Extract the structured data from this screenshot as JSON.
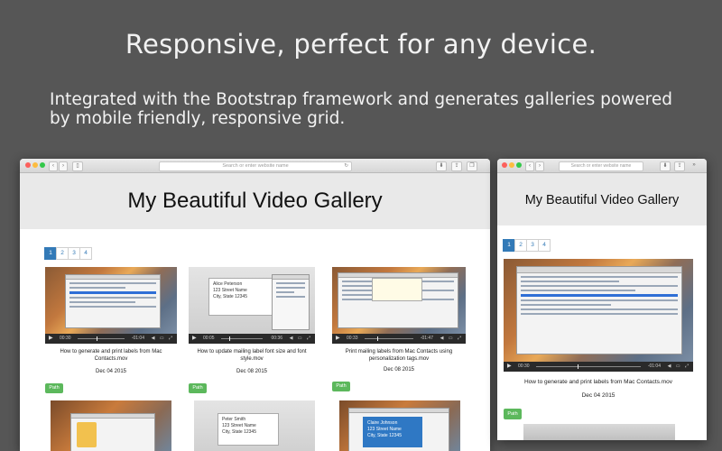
{
  "hero": {
    "title": "Responsive, perfect for any device.",
    "subtitle": "Integrated with the Bootstrap framework and generates galleries powered by mobile friendly, responsive grid."
  },
  "browser": {
    "address_placeholder": "Search or enter website name"
  },
  "gallery": {
    "title": "My Beautiful Video Gallery",
    "pages": [
      "1",
      "2",
      "3",
      "4"
    ],
    "active_page": "1",
    "path_label": "Path",
    "videos": [
      {
        "caption": "How to generate and print labels from Mac Contacts.mov",
        "date": "Dec 04 2015",
        "time_elapsed": "00:30",
        "time_remaining": "-01:04"
      },
      {
        "caption": "How to update mailing label font size and font style.mov",
        "date": "Dec 08 2015",
        "time_elapsed": "00:05",
        "time_remaining": "00:36",
        "card_name": "Alice Peterson",
        "card_street": "123 Street Name",
        "card_city": "City, State 12345"
      },
      {
        "caption": "Print mailing labels from Mac Contacts using personalization tags.mov",
        "date": "Dec 08 2015",
        "time_elapsed": "00:33",
        "time_remaining": "-01:47"
      },
      {
        "card_name": "Peter Smith",
        "card_street": "123 Street Name",
        "card_city": "City, State 12345"
      },
      {
        "card_name": "Claire Johnson",
        "card_street": "123 Street Name",
        "card_city": "City, State 12345"
      }
    ]
  },
  "colors": {
    "background": "#565656",
    "primary": "#337ab7",
    "success": "#5cb85c"
  }
}
